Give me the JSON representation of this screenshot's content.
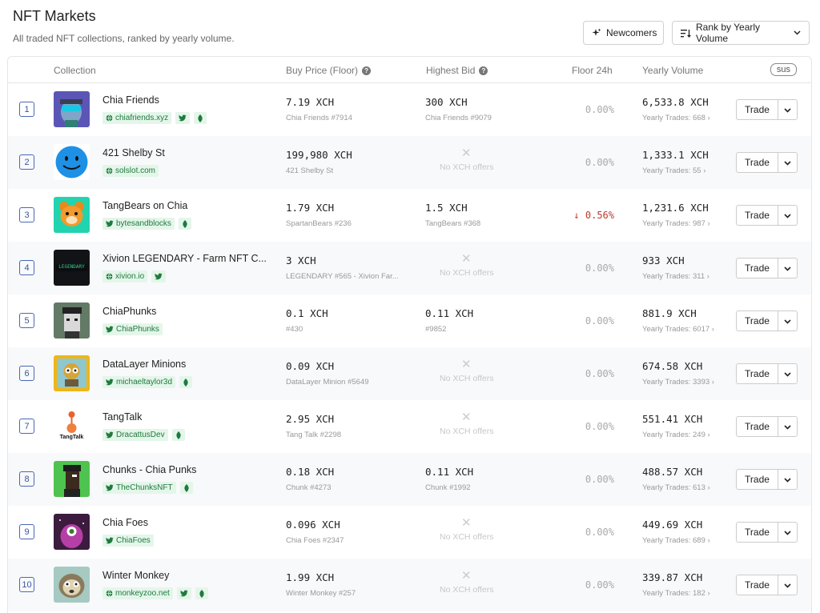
{
  "header": {
    "title": "NFT Markets",
    "subtitle": "All traded NFT collections, ranked by yearly volume.",
    "newcomers_label": "Newcomers",
    "rank_label": "Rank by Yearly Volume"
  },
  "columns": {
    "collection": "Collection",
    "buy_price": "Buy Price (Floor)",
    "highest_bid": "Highest Bid",
    "floor_24h": "Floor 24h",
    "yearly_volume": "Yearly Volume",
    "sus": "sus"
  },
  "trade_label": "Trade",
  "rows": [
    {
      "rank": "1",
      "name": "Chia Friends",
      "links": [
        {
          "type": "globe",
          "label": "chiafriends.xyz"
        },
        {
          "type": "twitter",
          "label": ""
        },
        {
          "type": "leaf",
          "label": ""
        }
      ],
      "price": "7.19 XCH",
      "price_sub": "Chia Friends #7914",
      "bid": "300 XCH",
      "bid_sub": "Chia Friends #9079",
      "floor": "0.00%",
      "floor_dir": "flat",
      "volume": "6,533.8 XCH",
      "trades": "Yearly Trades: 668 ›"
    },
    {
      "rank": "2",
      "name": "421 Shelby St",
      "links": [
        {
          "type": "globe",
          "label": "solslot.com"
        }
      ],
      "price": "199,980 XCH",
      "price_sub": "421 Shelby St",
      "bid": "",
      "bid_sub": "No XCH offers",
      "floor": "0.00%",
      "floor_dir": "flat",
      "volume": "1,333.1 XCH",
      "trades": "Yearly Trades: 55 ›"
    },
    {
      "rank": "3",
      "name": "TangBears on Chia",
      "links": [
        {
          "type": "twitter",
          "label": "bytesandblocks"
        },
        {
          "type": "leaf",
          "label": ""
        }
      ],
      "price": "1.79 XCH",
      "price_sub": "SpartanBears #236",
      "bid": "1.5 XCH",
      "bid_sub": "TangBears #368",
      "floor": "↓ 0.56%",
      "floor_dir": "down",
      "volume": "1,231.6 XCH",
      "trades": "Yearly Trades: 987 ›"
    },
    {
      "rank": "4",
      "name": "Xivion LEGENDARY - Farm NFT C...",
      "links": [
        {
          "type": "globe",
          "label": "xivion.io"
        },
        {
          "type": "twitter",
          "label": ""
        }
      ],
      "price": "3 XCH",
      "price_sub": "LEGENDARY #565 - Xivion Far...",
      "bid": "",
      "bid_sub": "No XCH offers",
      "floor": "0.00%",
      "floor_dir": "flat",
      "volume": "933 XCH",
      "trades": "Yearly Trades: 311 ›"
    },
    {
      "rank": "5",
      "name": "ChiaPhunks",
      "links": [
        {
          "type": "twitter",
          "label": "ChiaPhunks"
        }
      ],
      "price": "0.1 XCH",
      "price_sub": "#430",
      "bid": "0.11 XCH",
      "bid_sub": "#9852",
      "floor": "0.00%",
      "floor_dir": "flat",
      "volume": "881.9 XCH",
      "trades": "Yearly Trades: 6017 ›"
    },
    {
      "rank": "6",
      "name": "DataLayer Minions",
      "links": [
        {
          "type": "twitter",
          "label": "michaeltaylor3d"
        },
        {
          "type": "leaf",
          "label": ""
        }
      ],
      "price": "0.09 XCH",
      "price_sub": "DataLayer Minion #5649",
      "bid": "",
      "bid_sub": "No XCH offers",
      "floor": "0.00%",
      "floor_dir": "flat",
      "volume": "674.58 XCH",
      "trades": "Yearly Trades: 3393 ›"
    },
    {
      "rank": "7",
      "name": "TangTalk",
      "links": [
        {
          "type": "twitter",
          "label": "DracattusDev"
        },
        {
          "type": "leaf",
          "label": ""
        }
      ],
      "price": "2.95 XCH",
      "price_sub": "Tang Talk #2298",
      "bid": "",
      "bid_sub": "No XCH offers",
      "floor": "0.00%",
      "floor_dir": "flat",
      "volume": "551.41 XCH",
      "trades": "Yearly Trades: 249 ›"
    },
    {
      "rank": "8",
      "name": "Chunks - Chia Punks",
      "links": [
        {
          "type": "twitter",
          "label": "TheChunksNFT"
        },
        {
          "type": "leaf",
          "label": ""
        }
      ],
      "price": "0.18 XCH",
      "price_sub": "Chunk #4273",
      "bid": "0.11 XCH",
      "bid_sub": "Chunk #1992",
      "floor": "0.00%",
      "floor_dir": "flat",
      "volume": "488.57 XCH",
      "trades": "Yearly Trades: 613 ›"
    },
    {
      "rank": "9",
      "name": "Chia Foes",
      "links": [
        {
          "type": "twitter",
          "label": "ChiaFoes"
        }
      ],
      "price": "0.096 XCH",
      "price_sub": "Chia Foes #2347",
      "bid": "",
      "bid_sub": "No XCH offers",
      "floor": "0.00%",
      "floor_dir": "flat",
      "volume": "449.69 XCH",
      "trades": "Yearly Trades: 689 ›"
    },
    {
      "rank": "10",
      "name": "Winter Monkey",
      "links": [
        {
          "type": "globe",
          "label": "monkeyzoo.net"
        },
        {
          "type": "twitter",
          "label": ""
        },
        {
          "type": "leaf",
          "label": ""
        }
      ],
      "price": "1.99 XCH",
      "price_sub": "Winter Monkey #257",
      "bid": "",
      "bid_sub": "No XCH offers",
      "floor": "0.00%",
      "floor_dir": "flat",
      "volume": "339.87 XCH",
      "trades": "Yearly Trades: 182 ›"
    }
  ],
  "thumb_text": {
    "row4": "LEGENDARY",
    "row7": "TangTalk"
  },
  "colors": {
    "accent": "#3a55a0",
    "link_green": "#1f7a3d",
    "chip_bg": "#e4f6ea",
    "down_red": "#c0392b"
  }
}
